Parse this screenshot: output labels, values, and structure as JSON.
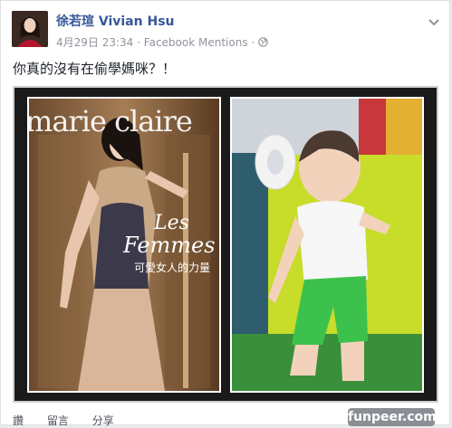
{
  "post": {
    "author": "徐若瑄 Vivian Hsu",
    "date": "4月29日 23:34",
    "separator": "·",
    "source": "Facebook Mentions",
    "audience_icon": "globe-icon",
    "text": "你真的沒有在偷學媽咪？！"
  },
  "magazine": {
    "title": "marie claire",
    "les": "Les",
    "femmes": "Femmes",
    "subtitle": "可愛女人的力量"
  },
  "actions": {
    "like_label": "讚",
    "comment_label": "留言",
    "share_label": "分享"
  },
  "watermark": "funpeer.com"
}
